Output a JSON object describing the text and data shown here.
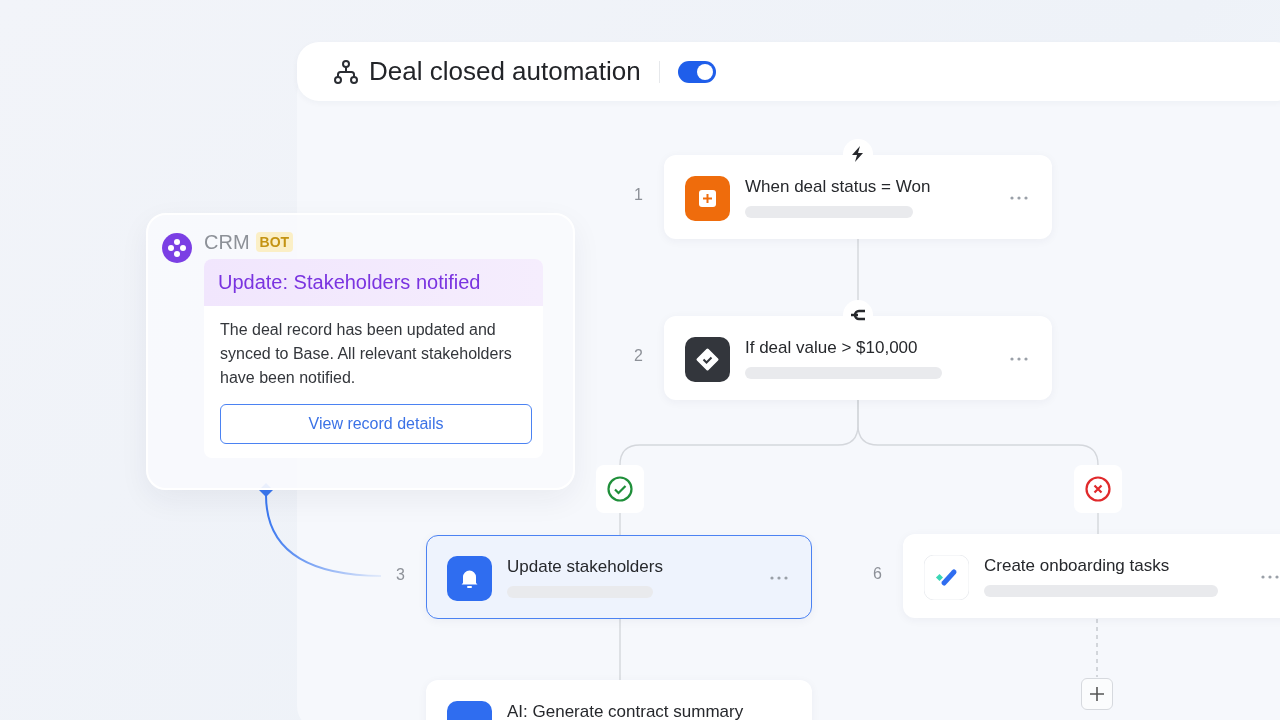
{
  "header": {
    "title": "Deal closed automation",
    "toggle": {
      "on": true
    }
  },
  "steps": [
    {
      "kind": "trigger",
      "number": "1",
      "title": "When deal status = Won",
      "selected": false
    },
    {
      "kind": "condition",
      "number": "2",
      "title": "If deal value > $10,000",
      "selected": false
    },
    {
      "kind": "notify",
      "number": "3",
      "title": "Update stakeholders",
      "selected": true
    },
    {
      "kind": "tasks",
      "number": "6",
      "title": "Create onboarding tasks",
      "selected": false
    },
    {
      "kind": "ai",
      "title": "AI: Generate contract summary",
      "selected": false
    }
  ],
  "branches": [
    {
      "kind": "yes"
    },
    {
      "kind": "no"
    }
  ],
  "message": {
    "sender": "CRM",
    "badge": "BOT",
    "title": "Update: Stakeholders notified",
    "body": "The deal record has been updated and synced to Base. All relevant stakeholders have been notified.",
    "button": "View record details"
  }
}
